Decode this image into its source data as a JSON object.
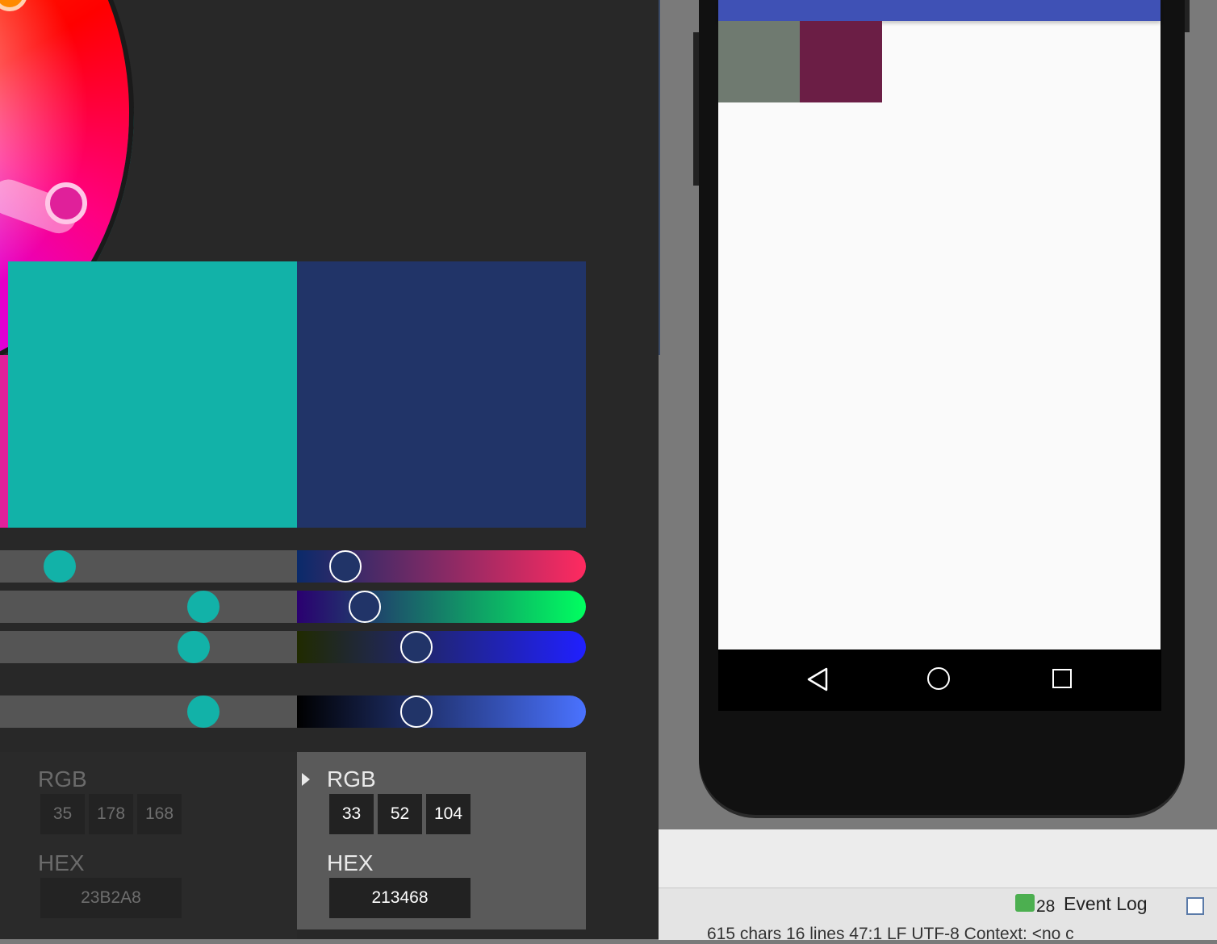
{
  "picker": {
    "original_color": "#12b2a8",
    "new_color": "#213468",
    "sliders": [
      {
        "name": "red",
        "old_value": 35,
        "new_value": 33,
        "gradient": [
          "#0a2a6a",
          "#ff2a60"
        ]
      },
      {
        "name": "green",
        "old_value": 178,
        "new_value": 52,
        "gradient": [
          "#2a0070",
          "#00ff60"
        ]
      },
      {
        "name": "blue",
        "old_value": 168,
        "new_value": 104,
        "gradient": [
          "#202a00",
          "#2020ff"
        ]
      },
      {
        "name": "brightness",
        "old_value": 0.7,
        "new_value": 0.41,
        "gradient": [
          "#000000",
          "#4a72ff"
        ]
      }
    ],
    "old_values": {
      "rgb_label": "RGB",
      "r": "35",
      "g": "178",
      "b": "168",
      "hex_label": "HEX",
      "hex": "23B2A8"
    },
    "new_values": {
      "rgb_label": "RGB",
      "r": "33",
      "g": "52",
      "b": "104",
      "hex_label": "HEX",
      "hex": "213468"
    }
  },
  "preview": {
    "app_bar_color": "#3f51b5",
    "block_colors": [
      "#6f7a70",
      "#6b1e45"
    ]
  },
  "ide": {
    "event_log_count": "28",
    "event_log_label": "Event Log",
    "status_text": "615 chars 16 lines 47:1 LF UTF-8 Context: <no c"
  }
}
